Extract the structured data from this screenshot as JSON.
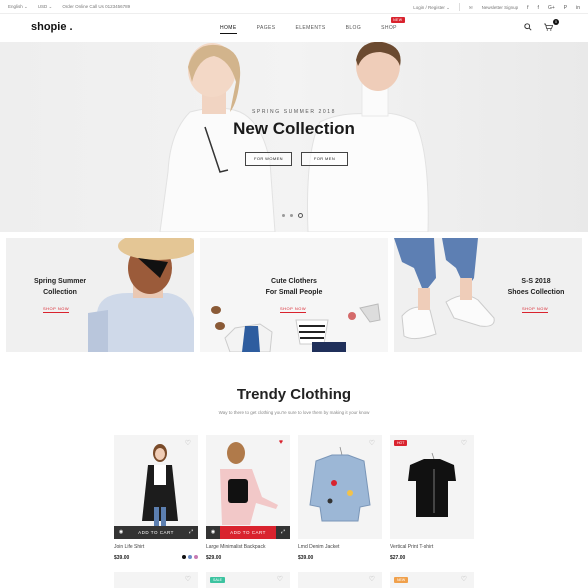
{
  "topbar": {
    "language": "English ⌄",
    "currency": "USD ⌄",
    "order_text": "Order Online Call Us 0123456789",
    "login": "Login / Register ⌄",
    "newsletter": "Newsletter Signup",
    "social": [
      "f",
      "f",
      "G+",
      "P",
      "in"
    ]
  },
  "header": {
    "logo": "shopie .",
    "nav": [
      {
        "label": "HOME"
      },
      {
        "label": "PAGES"
      },
      {
        "label": "ELEMENTS"
      },
      {
        "label": "BLOG"
      },
      {
        "label": "SHOP",
        "badge": "NEW"
      }
    ],
    "cart_count": "0"
  },
  "hero": {
    "subtitle": "SPRING SUMMER 2018",
    "title": "New Collection",
    "btn_women": "FOR WOMEN",
    "btn_men": "FOR MEN"
  },
  "banners": [
    {
      "title_line1": "Spring Summer",
      "title_line2": "Collection",
      "cta": "SHOP NOW"
    },
    {
      "title_line1": "Cute Clothers",
      "title_line2": "For Small People",
      "cta": "SHOP NOW"
    },
    {
      "title_line1": "S-S 2018",
      "title_line2": "Shoes Collection",
      "cta": "SHOP NOW"
    }
  ],
  "section": {
    "title": "Trendy Clothing",
    "subtitle": "Way to there to get clothing you're sure to love them by making it your know"
  },
  "products": [
    {
      "name": "Join Life Shirt",
      "price": "$39.00",
      "cart_label": "ADD TO CART"
    },
    {
      "name": "Large Minimalist Backpack",
      "price": "$29.00",
      "cart_label": "ADD TO CART"
    },
    {
      "name": "Lmd Denim Jacket",
      "price": "$39.00"
    },
    {
      "name": "Vertical Print T-shirt",
      "price": "$27.00",
      "tag": "HOT"
    }
  ],
  "second_row_tags": [
    "SALE",
    "NEW"
  ],
  "colors": {
    "accent": "#d9232e",
    "dark": "#333333",
    "sale": "#3cc3a0",
    "new": "#f0a04b"
  }
}
